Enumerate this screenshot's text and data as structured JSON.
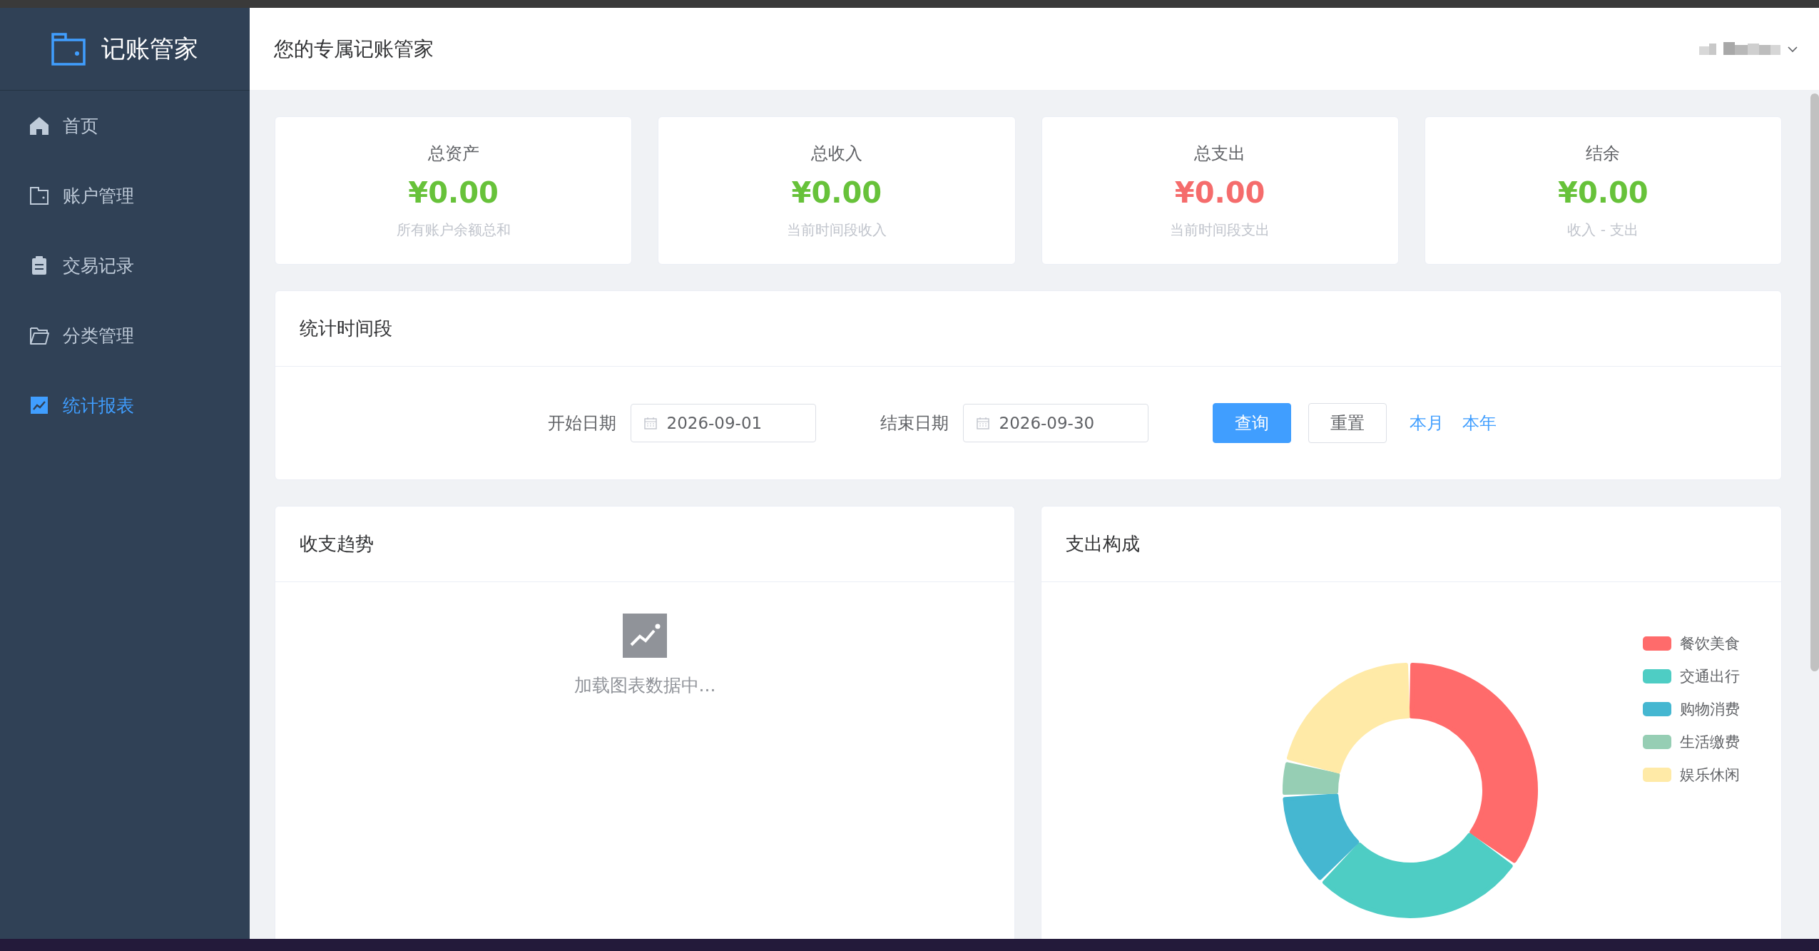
{
  "app": {
    "logo": "记账管家",
    "subtitle": "您的专属记账管家"
  },
  "sidebar": {
    "items": [
      {
        "label": "首页",
        "kind": "home",
        "selected": false
      },
      {
        "label": "账户管理",
        "kind": "wallet",
        "selected": false
      },
      {
        "label": "交易记录",
        "kind": "clipboard",
        "selected": false
      },
      {
        "label": "分类管理",
        "kind": "folder",
        "selected": false
      },
      {
        "label": "统计报表",
        "kind": "chart",
        "selected": true
      }
    ]
  },
  "stats": [
    {
      "title": "总资产",
      "value": "¥0.00",
      "note": "所有账户余额总和",
      "kind": "positive"
    },
    {
      "title": "总收入",
      "value": "¥0.00",
      "note": "当前时间段收入",
      "kind": "positive"
    },
    {
      "title": "总支出",
      "value": "¥0.00",
      "note": "当前时间段支出",
      "kind": "negative"
    },
    {
      "title": "结余",
      "value": "¥0.00",
      "note": "收入 - 支出",
      "kind": "positive"
    }
  ],
  "period": {
    "title": "统计时间段",
    "start": {
      "label": "开始日期",
      "value": "2026-09-01"
    },
    "end": {
      "label": "结束日期",
      "value": "2026-09-30"
    },
    "buttons": [
      {
        "label": "查询",
        "kind": "primary"
      },
      {
        "label": "重置",
        "kind": "default"
      },
      {
        "label": "本月",
        "kind": "link"
      },
      {
        "label": "本年",
        "kind": "link"
      }
    ]
  },
  "trend": {
    "title": "收支趋势",
    "loading_text": "加载图表数据中..."
  },
  "expense": {
    "title": "支出构成",
    "legend": [
      {
        "label": "餐饮美食",
        "color": "#ff6b6b"
      },
      {
        "label": "交通出行",
        "color": "#4ecdc4"
      },
      {
        "label": "购物消费",
        "color": "#45b7d1"
      },
      {
        "label": "生活缴费",
        "color": "#96ceb4"
      },
      {
        "label": "娱乐休闲",
        "color": "#ffeaa7"
      }
    ]
  }
}
